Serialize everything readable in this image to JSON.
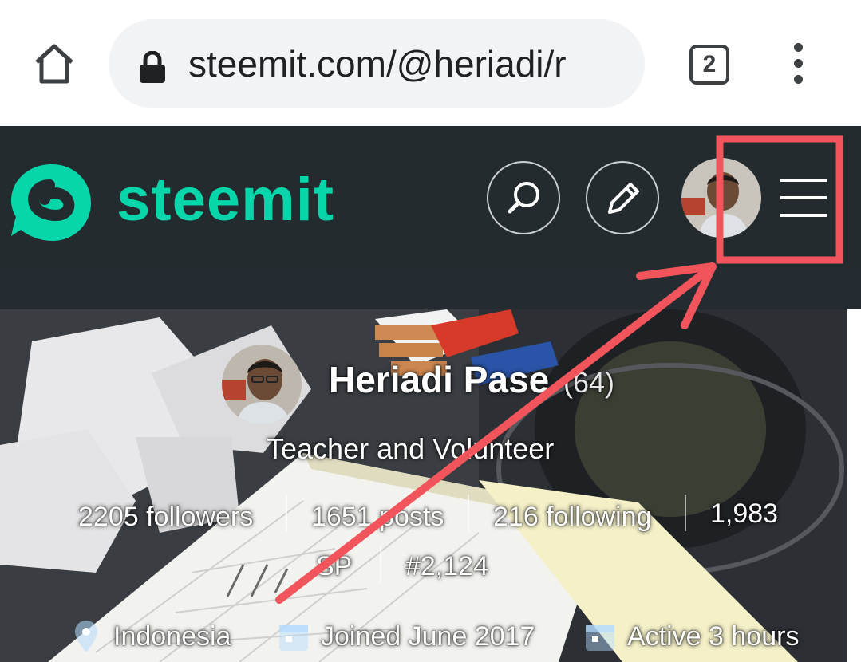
{
  "browser": {
    "url": "steemit.com/@heriadi/r",
    "tab_count": "2"
  },
  "header": {
    "brand": "steemit"
  },
  "profile": {
    "name": "Heriadi Pase",
    "reputation": "(64)",
    "about": "Teacher and Volunteer",
    "followers": "2205 followers",
    "posts": "1651 posts",
    "following": "216 following",
    "sp_value": "1,983",
    "sp_label": "SP",
    "rank": "#2,124",
    "location": "Indonesia",
    "joined": "Joined June 2017",
    "active": "Active 3 hours"
  },
  "icons": [
    "home-icon",
    "lock-icon",
    "tab-switcher-icon",
    "more-vert-icon",
    "steemit-logo",
    "search-icon",
    "pencil-icon",
    "menu-icon",
    "location-icon",
    "calendar-icon"
  ],
  "colors": {
    "brand": "#06d6a9",
    "header_bg": "#232b2f",
    "annotation": "#f2545b"
  }
}
